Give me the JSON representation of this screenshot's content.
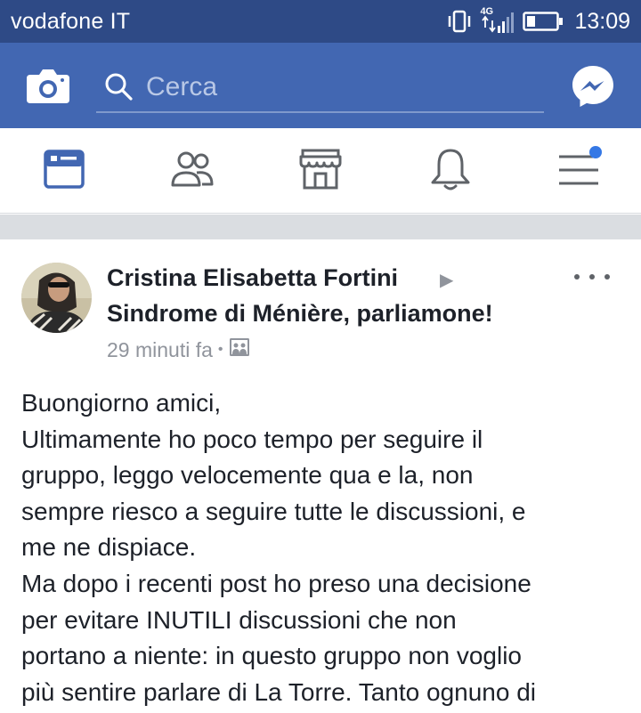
{
  "status_bar": {
    "carrier": "vodafone IT",
    "network": "4G",
    "time": "13:09"
  },
  "top_bar": {
    "camera_icon": "camera-icon",
    "search": {
      "placeholder": "Cerca",
      "value": ""
    },
    "messenger_icon": "messenger-icon"
  },
  "nav": {
    "items": [
      {
        "name": "news-feed",
        "icon": "news-feed-icon",
        "active": true
      },
      {
        "name": "friends",
        "icon": "friends-icon",
        "active": false
      },
      {
        "name": "marketplace",
        "icon": "marketplace-icon",
        "active": false
      },
      {
        "name": "notifications",
        "icon": "bell-icon",
        "active": false
      },
      {
        "name": "menu",
        "icon": "menu-icon",
        "active": false,
        "badge_dot": true
      }
    ]
  },
  "post": {
    "author": "Cristina Elisabetta Fortini",
    "arrow": "▶",
    "group": "Sindrome di Ménière, parliamone!",
    "time": "29 minuti fa",
    "separator": "•",
    "privacy_icon": "group-privacy-icon",
    "text_lines": [
      "Buongiorno amici,",
      "Ultimamente ho poco tempo per seguire il",
      "gruppo, leggo velocemente qua e la, non",
      "sempre riesco a seguire tutte le discussioni, e",
      "me ne dispiace.",
      "Ma dopo i recenti post ho preso una decisione",
      "per evitare INUTILI discussioni che non",
      "portano a niente: in questo gruppo non voglio",
      "più sentire parlare di La Torre. Tanto ognuno di"
    ]
  },
  "colors": {
    "status_bar_bg": "#2e4a86",
    "top_bar_bg": "#4267b2",
    "accent": "#4267b2",
    "badge": "#3578e5"
  }
}
